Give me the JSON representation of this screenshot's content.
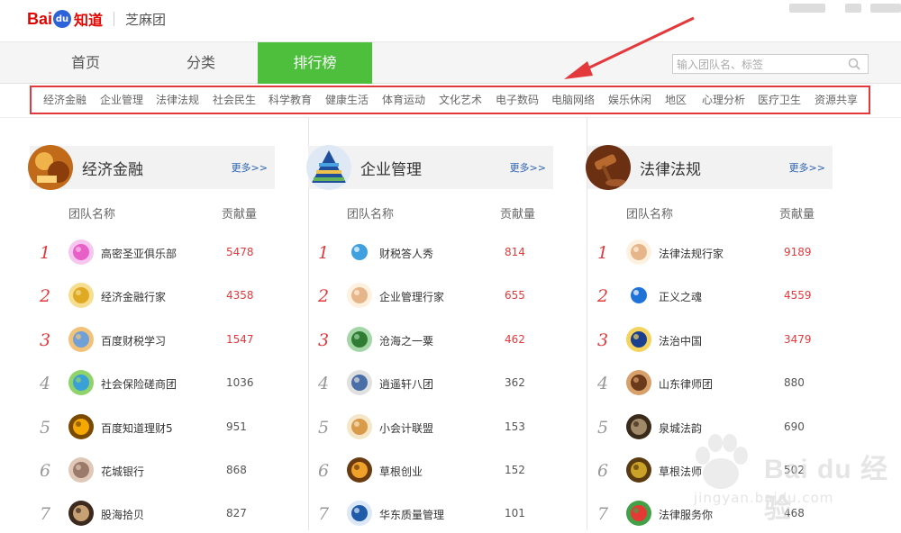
{
  "header": {
    "logo_bai": "Bai",
    "logo_du": "du",
    "logo_zhidao": "知道",
    "group_name": "芝麻团"
  },
  "nav": {
    "tabs": [
      {
        "label": "首页",
        "active": false
      },
      {
        "label": "分类",
        "active": false
      },
      {
        "label": "排行榜",
        "active": true
      }
    ],
    "search_placeholder": "输入团队名、标签"
  },
  "categories": [
    "经济金融",
    "企业管理",
    "法律法规",
    "社会民生",
    "科学教育",
    "健康生活",
    "体育运动",
    "文化艺术",
    "电子数码",
    "电脑网络",
    "娱乐休闲",
    "地区",
    "心理分析",
    "医疗卫生",
    "资源共享"
  ],
  "columns": [
    {
      "title": "经济金融",
      "more": "更多>>",
      "col_name": "团队名称",
      "col_contrib": "贡献量",
      "icon": "finance-avatar",
      "rows": [
        {
          "rank": "1",
          "name": "高密圣亚俱乐部",
          "value": "5478",
          "icon": "club-icon"
        },
        {
          "rank": "2",
          "name": "经济金融行家",
          "value": "4358",
          "icon": "expert-icon"
        },
        {
          "rank": "3",
          "name": "百度财税学习",
          "value": "1547",
          "icon": "tax-icon"
        },
        {
          "rank": "4",
          "name": "社会保险磋商团",
          "value": "1036",
          "icon": "insurance-icon"
        },
        {
          "rank": "5",
          "name": "百度知道理财5",
          "value": "951",
          "icon": "sunflower-icon"
        },
        {
          "rank": "6",
          "name": "花城银行",
          "value": "868",
          "icon": "bank-icon"
        },
        {
          "rank": "7",
          "name": "股海拾贝",
          "value": "827",
          "icon": "stock-icon"
        }
      ]
    },
    {
      "title": "企业管理",
      "more": "更多>>",
      "col_name": "团队名称",
      "col_contrib": "贡献量",
      "icon": "pyramid-avatar",
      "rows": [
        {
          "rank": "1",
          "name": "财税答人秀",
          "value": "814",
          "icon": "tax-answer-icon"
        },
        {
          "rank": "2",
          "name": "企业管理行家",
          "value": "655",
          "icon": "bear-icon"
        },
        {
          "rank": "3",
          "name": "沧海之一粟",
          "value": "462",
          "icon": "green-icon"
        },
        {
          "rank": "4",
          "name": "逍遥轩八团",
          "value": "362",
          "icon": "bird-icon"
        },
        {
          "rank": "5",
          "name": "小会计联盟",
          "value": "153",
          "icon": "accounting-icon"
        },
        {
          "rank": "6",
          "name": "草根创业",
          "value": "152",
          "icon": "grass-icon"
        },
        {
          "rank": "7",
          "name": "华东质量管理",
          "value": "101",
          "icon": "iso-icon"
        }
      ]
    },
    {
      "title": "法律法规",
      "more": "更多>>",
      "col_name": "团队名称",
      "col_contrib": "贡献量",
      "icon": "gavel-avatar",
      "rows": [
        {
          "rank": "1",
          "name": "法律法规行家",
          "value": "9189",
          "icon": "bear-icon"
        },
        {
          "rank": "2",
          "name": "正义之魂",
          "value": "4559",
          "icon": "justice-icon"
        },
        {
          "rank": "3",
          "name": "法治中国",
          "value": "3479",
          "icon": "emblem-icon"
        },
        {
          "rank": "4",
          "name": "山东律师团",
          "value": "880",
          "icon": "lawyer-icon"
        },
        {
          "rank": "5",
          "name": "泉城法韵",
          "value": "690",
          "icon": "seal-icon"
        },
        {
          "rank": "6",
          "name": "草根法师",
          "value": "502",
          "icon": "law-icon"
        },
        {
          "rank": "7",
          "name": "法律服务你",
          "value": "468",
          "icon": "pinwheel-icon"
        }
      ]
    }
  ],
  "watermark": {
    "brand": "Bai du 经验",
    "url": "jingyan.baidu.com"
  },
  "colors": {
    "accent_green": "#4dbf3d",
    "highlight_red": "#e4393c",
    "link_blue": "#2d64b3"
  }
}
